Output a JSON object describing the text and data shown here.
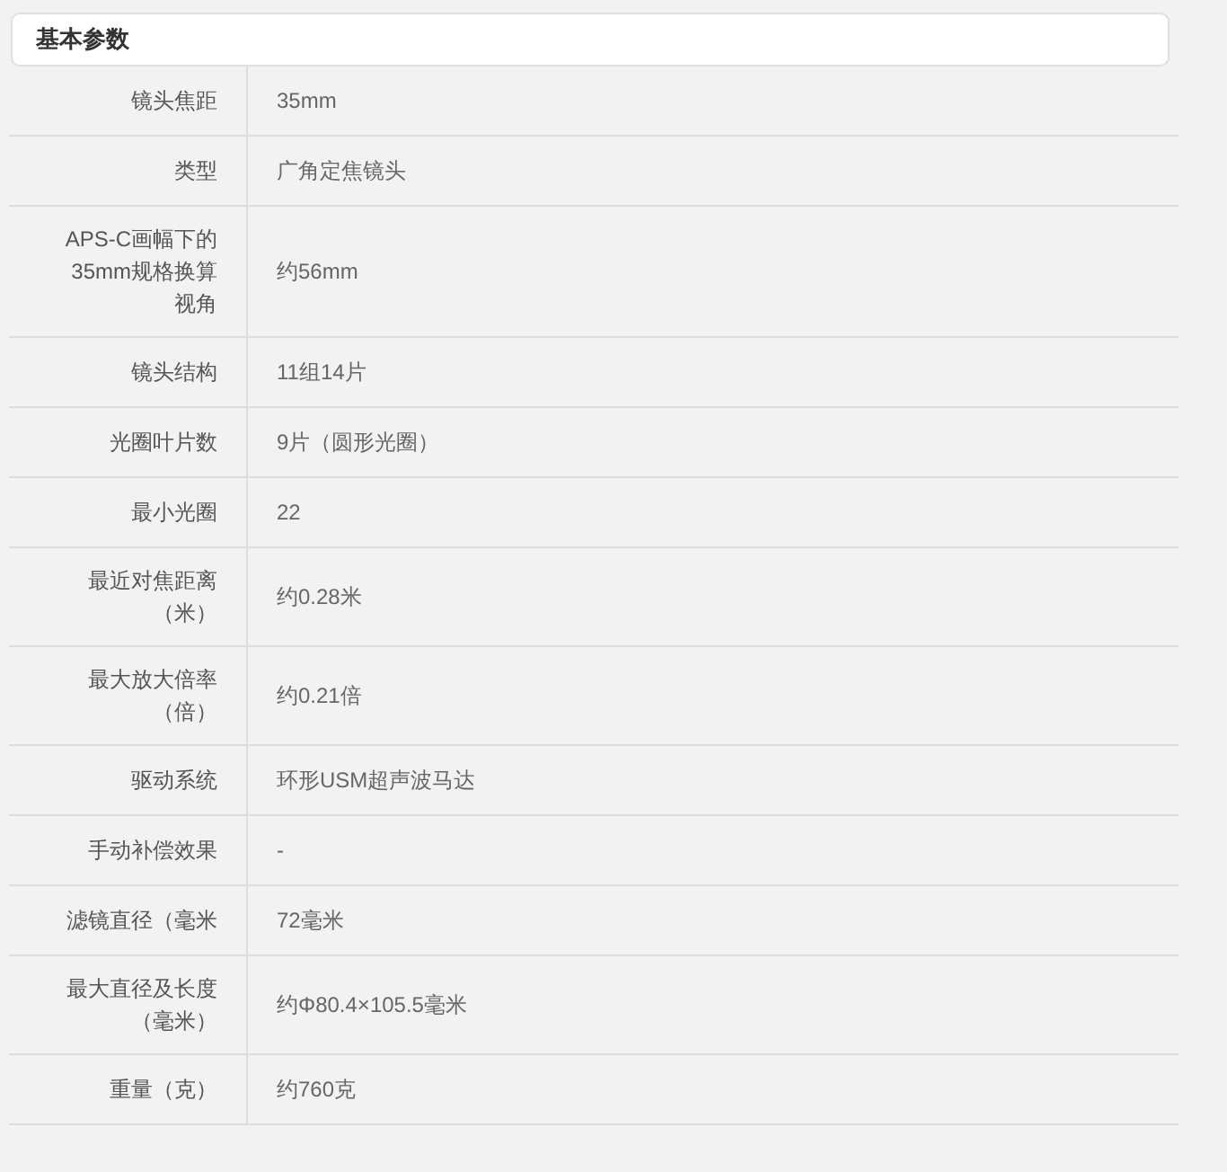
{
  "section": {
    "title": "基本参数"
  },
  "rows": [
    {
      "label": "镜头焦距",
      "value": "35mm"
    },
    {
      "label": "类型",
      "value": "广角定焦镜头"
    },
    {
      "label": "APS-C画幅下的35mm规格换算视角",
      "value": "约56mm"
    },
    {
      "label": "镜头结构",
      "value": "11组14片"
    },
    {
      "label": "光圈叶片数",
      "value": "9片（圆形光圈）"
    },
    {
      "label": "最小光圈",
      "value": "22"
    },
    {
      "label": "最近对焦距离（米）",
      "value": "约0.28米"
    },
    {
      "label": "最大放大倍率（倍）",
      "value": "约0.21倍"
    },
    {
      "label": "驱动系统",
      "value": "环形USM超声波马达"
    },
    {
      "label": "手动补偿效果",
      "value": "-"
    },
    {
      "label": "滤镜直径（毫米",
      "value": "72毫米"
    },
    {
      "label": "最大直径及长度（毫米）",
      "value": "约Φ80.4×105.5毫米"
    },
    {
      "label": "重量（克）",
      "value": "约760克"
    }
  ]
}
